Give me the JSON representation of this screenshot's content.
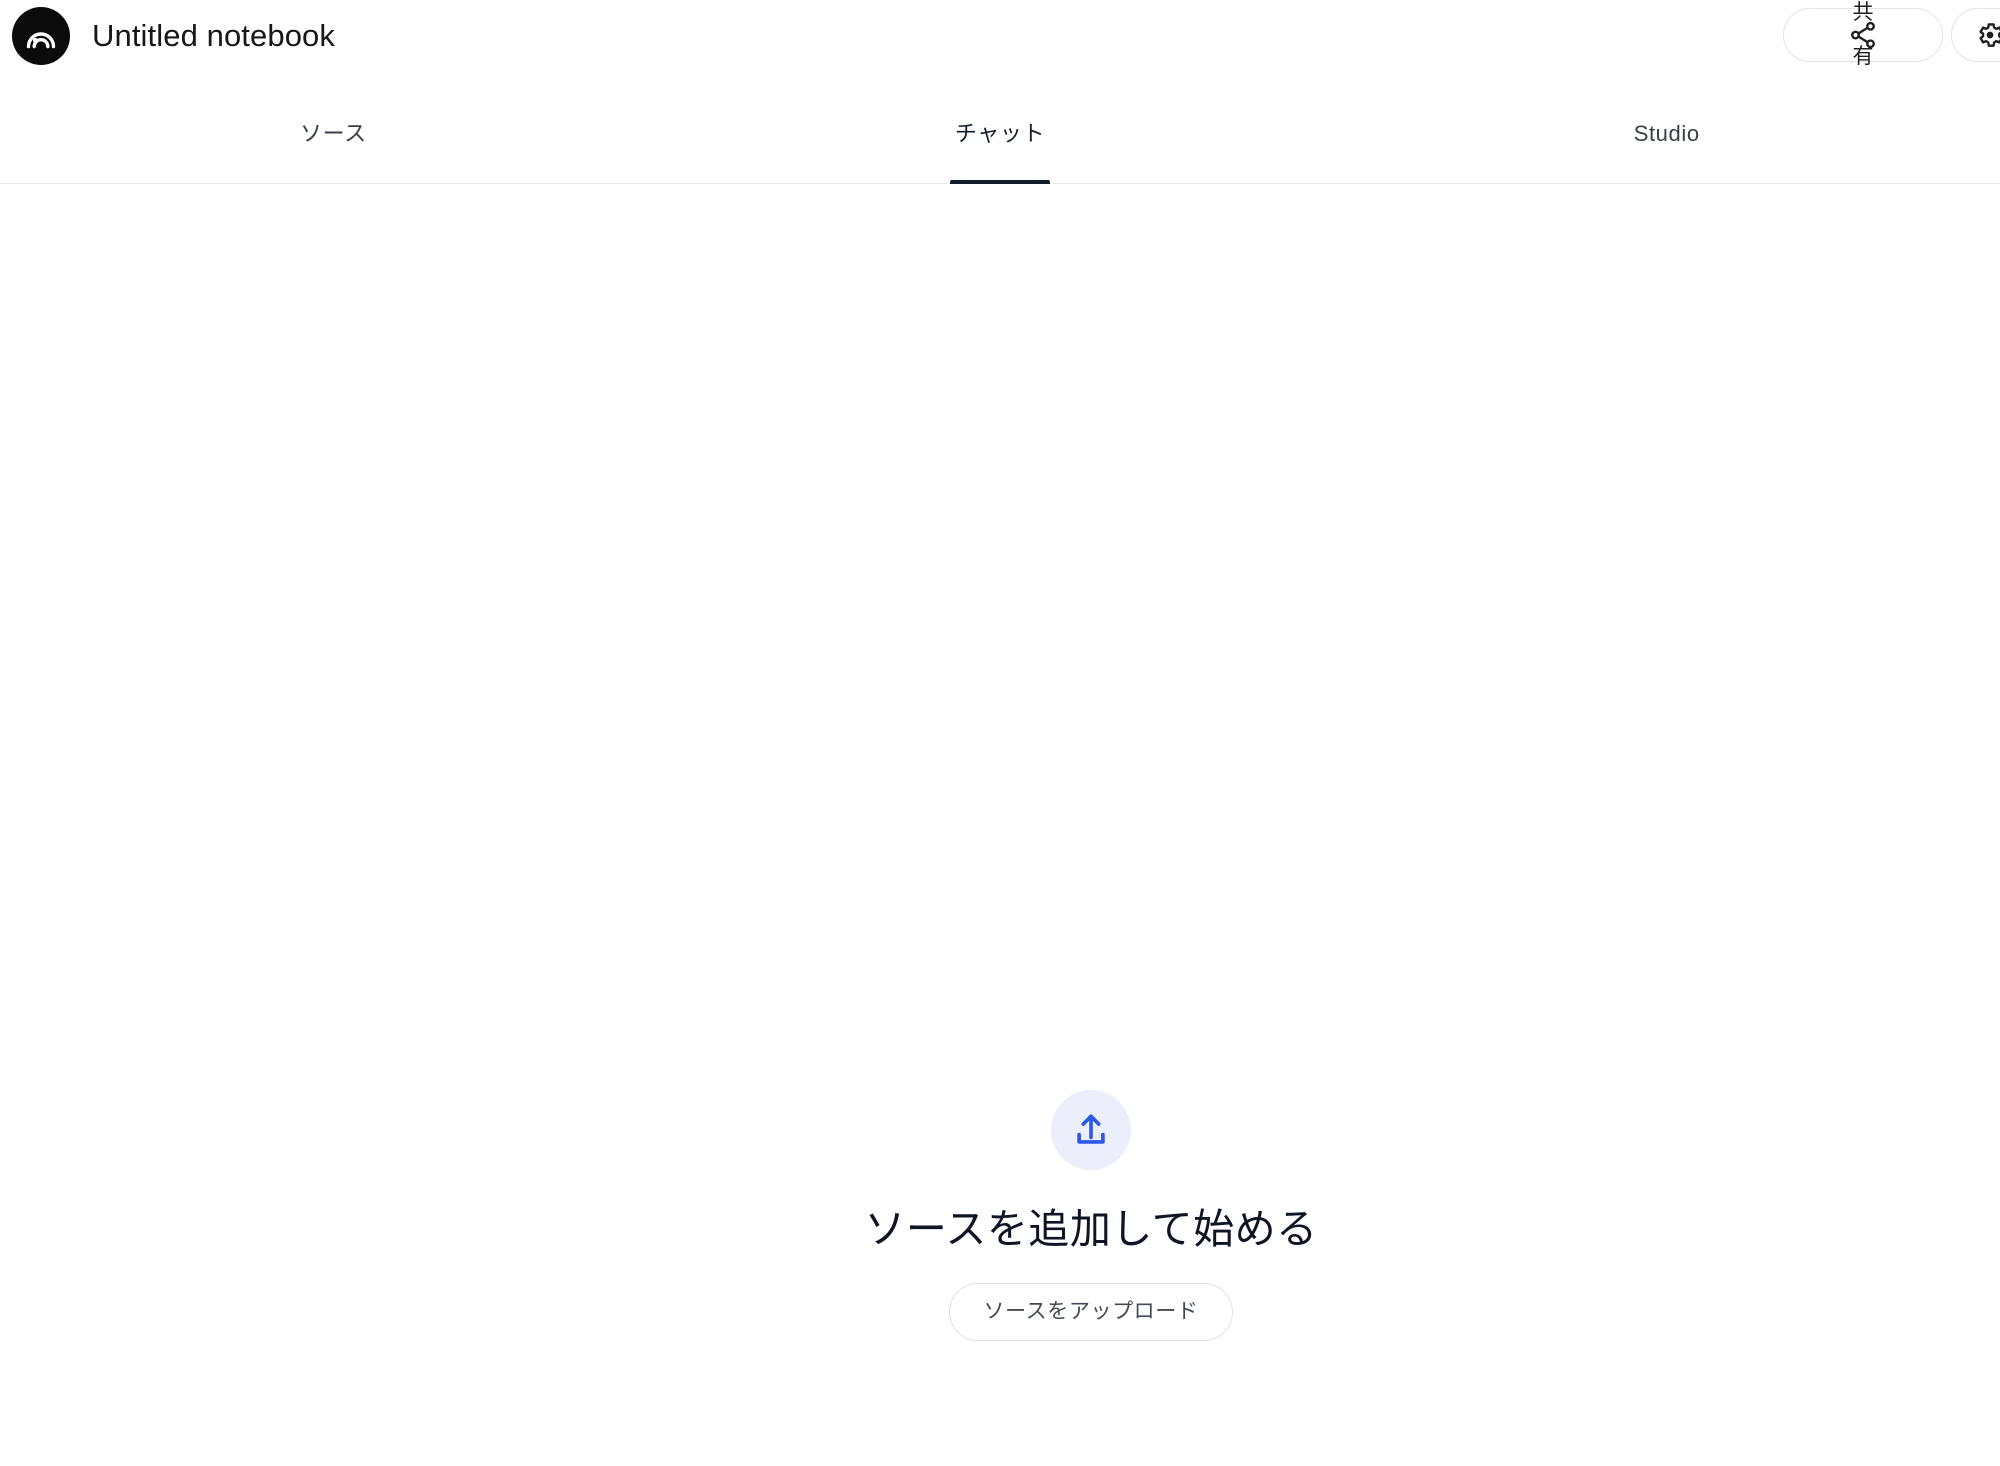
{
  "app": {
    "logo_icon": "notebooklm-logo-icon",
    "notebook_title": "Untitled notebook"
  },
  "topbar": {
    "share": {
      "label": "共有",
      "icon": "share-icon"
    },
    "settings": {
      "icon": "gear-icon"
    }
  },
  "tabs": [
    {
      "id": "sources",
      "label": "ソース",
      "active": false
    },
    {
      "id": "chat",
      "label": "チャット",
      "active": true
    },
    {
      "id": "studio",
      "label": "Studio",
      "active": false
    }
  ],
  "main": {
    "empty_state": {
      "icon": "upload-icon",
      "heading": "ソースを追加して始める",
      "button_label": "ソースをアップロード"
    }
  },
  "colors": {
    "accent_blue": "#2f57e8",
    "accent_blue_soft": "#eceefc",
    "active_tab": "#131c2b",
    "divider": "#e8eaed",
    "logo_bg": "#0b0b0c"
  }
}
